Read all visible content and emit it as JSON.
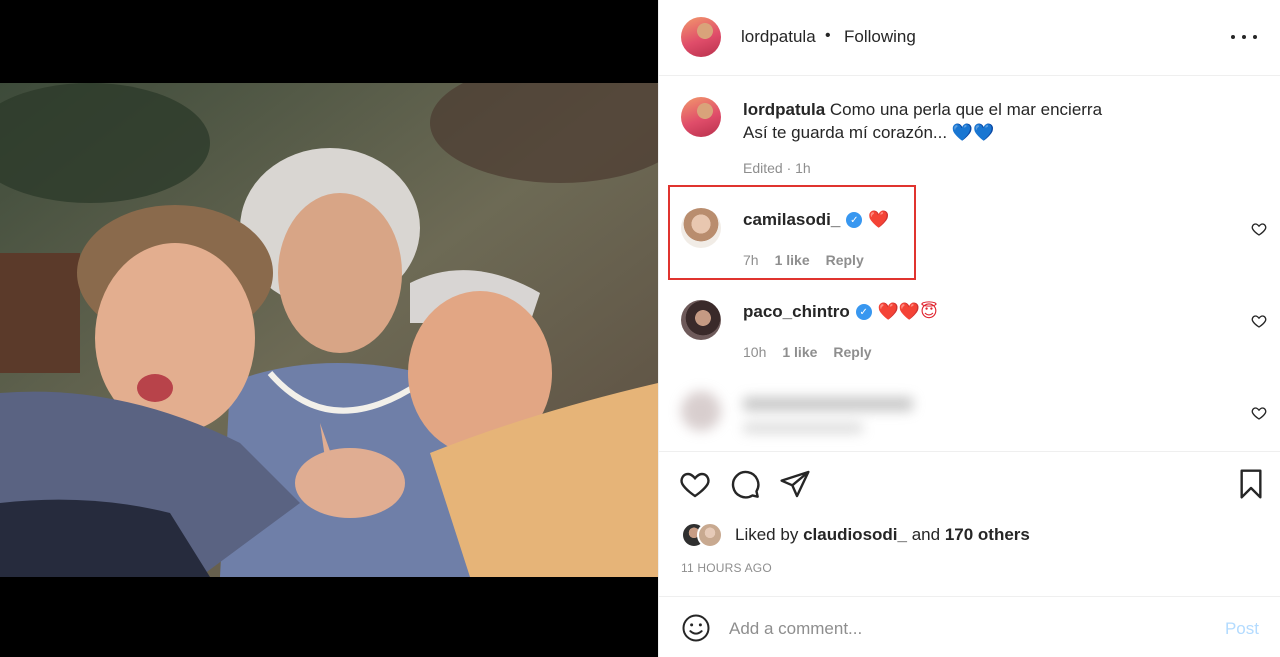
{
  "post": {
    "owner": "lordpatula",
    "separator": "•",
    "follow_status": "Following",
    "caption_line1": "Como una perla que el mar encierra",
    "caption_line2": "Así te guarda mí corazón... 💙💙",
    "caption_meta": "Edited · 1h"
  },
  "comments": [
    {
      "user": "camilasodi_",
      "verified": "✓",
      "text": "❤️",
      "time": "7h",
      "likes": "1 like",
      "reply": "Reply"
    },
    {
      "user": "paco_chintro",
      "verified": "✓",
      "text": "❤️❤️😇",
      "time": "10h",
      "likes": "1 like",
      "reply": "Reply"
    }
  ],
  "likes": {
    "prefix": "Liked by",
    "user": "claudiosodi_",
    "middle": "and",
    "others": "170 others"
  },
  "timestamp": "11 HOURS AGO",
  "compose": {
    "placeholder": "Add a comment...",
    "post_label": "Post"
  },
  "icons": {
    "more": "more-options-icon",
    "like": "heart-icon",
    "comment": "comment-icon",
    "share": "share-icon",
    "save": "bookmark-icon",
    "emoji": "emoji-icon"
  },
  "colors": {
    "highlight_box": "#e0342f",
    "verified_badge": "#3897f0",
    "post_button_disabled": "#b3dbff"
  }
}
